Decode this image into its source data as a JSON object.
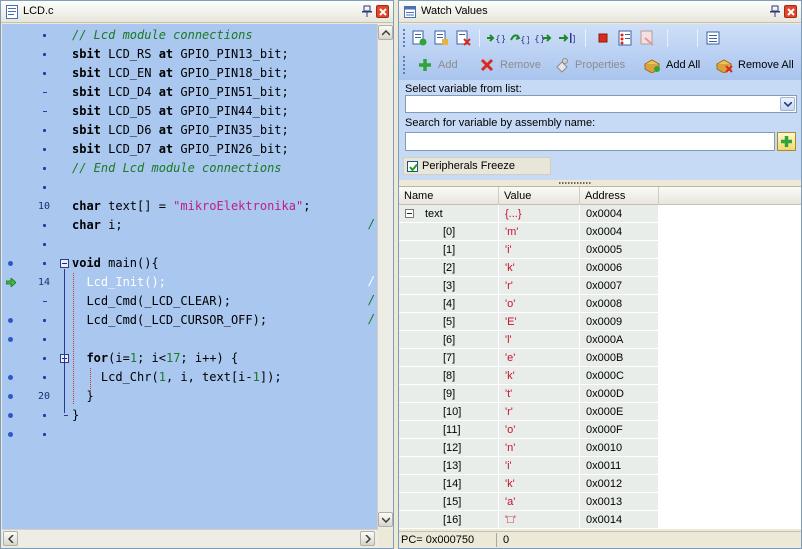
{
  "editor": {
    "title": "LCD.c",
    "gutter_numbers": [
      "10",
      "14",
      "20"
    ],
    "lines": [
      {
        "segments": [
          {
            "c": "cm",
            "t": "// Lcd module connections"
          }
        ]
      },
      {
        "segments": [
          {
            "c": "kw",
            "t": "sbit"
          },
          {
            "c": "plain",
            "t": " LCD_RS "
          },
          {
            "c": "kw",
            "t": "at"
          },
          {
            "c": "plain",
            "t": " GPIO_PIN13_bit;"
          }
        ]
      },
      {
        "segments": [
          {
            "c": "kw",
            "t": "sbit"
          },
          {
            "c": "plain",
            "t": " LCD_EN "
          },
          {
            "c": "kw",
            "t": "at"
          },
          {
            "c": "plain",
            "t": " GPIO_PIN18_bit;"
          }
        ]
      },
      {
        "segments": [
          {
            "c": "kw",
            "t": "sbit"
          },
          {
            "c": "plain",
            "t": " LCD_D4 "
          },
          {
            "c": "kw",
            "t": "at"
          },
          {
            "c": "plain",
            "t": " GPIO_PIN51_bit;"
          }
        ]
      },
      {
        "segments": [
          {
            "c": "kw",
            "t": "sbit"
          },
          {
            "c": "plain",
            "t": " LCD_D5 "
          },
          {
            "c": "kw",
            "t": "at"
          },
          {
            "c": "plain",
            "t": " GPIO_PIN44_bit;"
          }
        ]
      },
      {
        "segments": [
          {
            "c": "kw",
            "t": "sbit"
          },
          {
            "c": "plain",
            "t": " LCD_D6 "
          },
          {
            "c": "kw",
            "t": "at"
          },
          {
            "c": "plain",
            "t": " GPIO_PIN35_bit;"
          }
        ]
      },
      {
        "segments": [
          {
            "c": "kw",
            "t": "sbit"
          },
          {
            "c": "plain",
            "t": " LCD_D7 "
          },
          {
            "c": "kw",
            "t": "at"
          },
          {
            "c": "plain",
            "t": " GPIO_PIN26_bit;"
          }
        ]
      },
      {
        "segments": [
          {
            "c": "cm",
            "t": "// End Lcd module connections"
          }
        ]
      },
      {
        "segments": []
      },
      {
        "segments": [
          {
            "c": "kw",
            "t": "char"
          },
          {
            "c": "plain",
            "t": " text[] = "
          },
          {
            "c": "str",
            "t": "\"mikroElektronika\""
          },
          {
            "c": "plain",
            "t": ";"
          }
        ]
      },
      {
        "segments": [
          {
            "c": "kw",
            "t": "char"
          },
          {
            "c": "plain",
            "t": " i;"
          }
        ]
      },
      {
        "segments": []
      },
      {
        "segments": [
          {
            "c": "kw",
            "t": "void"
          },
          {
            "c": "plain",
            "t": " main(){"
          }
        ]
      },
      {
        "segments": [
          {
            "c": "plain",
            "t": "  Lcd_Init();"
          }
        ]
      },
      {
        "segments": [
          {
            "c": "plain",
            "t": "  Lcd_Cmd(_LCD_CLEAR);"
          }
        ]
      },
      {
        "segments": [
          {
            "c": "plain",
            "t": "  Lcd_Cmd(_LCD_CURSOR_OFF);"
          }
        ]
      },
      {
        "segments": []
      },
      {
        "segments": [
          {
            "c": "plain",
            "t": "  "
          },
          {
            "c": "kw",
            "t": "for"
          },
          {
            "c": "plain",
            "t": "(i="
          },
          {
            "c": "nm",
            "t": "1"
          },
          {
            "c": "plain",
            "t": "; i<"
          },
          {
            "c": "nm",
            "t": "17"
          },
          {
            "c": "plain",
            "t": "; i++) {"
          }
        ]
      },
      {
        "segments": [
          {
            "c": "plain",
            "t": "    Lcd_Chr("
          },
          {
            "c": "nm",
            "t": "1"
          },
          {
            "c": "plain",
            "t": ", i, text[i-"
          },
          {
            "c": "nm",
            "t": "1"
          },
          {
            "c": "plain",
            "t": "]);"
          }
        ]
      },
      {
        "segments": [
          {
            "c": "plain",
            "t": "  }"
          }
        ]
      },
      {
        "segments": [
          {
            "c": "plain",
            "t": "}"
          }
        ]
      }
    ],
    "slash_char": "/"
  },
  "watch": {
    "title": "Watch Values",
    "toolbar": {
      "add_label": "Add",
      "remove_label": "Remove",
      "properties_label": "Properties",
      "add_all_label": "Add All",
      "remove_all_label": "Remove All"
    },
    "select_label": "Select variable from list:",
    "select_value": "",
    "search_label": "Search for variable by assembly name:",
    "search_value": "",
    "freeze_label": "Peripherals Freeze",
    "freeze_checked": true,
    "columns": {
      "name": "Name",
      "value": "Value",
      "address": "Address"
    },
    "parent": {
      "name": "text",
      "value": "{...}",
      "address": "0x0004"
    },
    "rows": [
      {
        "name": "[0]",
        "value": "'m'",
        "address": "0x0004"
      },
      {
        "name": "[1]",
        "value": "'i'",
        "address": "0x0005"
      },
      {
        "name": "[2]",
        "value": "'k'",
        "address": "0x0006"
      },
      {
        "name": "[3]",
        "value": "'r'",
        "address": "0x0007"
      },
      {
        "name": "[4]",
        "value": "'o'",
        "address": "0x0008"
      },
      {
        "name": "[5]",
        "value": "'E'",
        "address": "0x0009"
      },
      {
        "name": "[6]",
        "value": "'l'",
        "address": "0x000A"
      },
      {
        "name": "[7]",
        "value": "'e'",
        "address": "0x000B"
      },
      {
        "name": "[8]",
        "value": "'k'",
        "address": "0x000C"
      },
      {
        "name": "[9]",
        "value": "'t'",
        "address": "0x000D"
      },
      {
        "name": "[10]",
        "value": "'r'",
        "address": "0x000E"
      },
      {
        "name": "[11]",
        "value": "'o'",
        "address": "0x000F"
      },
      {
        "name": "[12]",
        "value": "'n'",
        "address": "0x0010"
      },
      {
        "name": "[13]",
        "value": "'i'",
        "address": "0x0011"
      },
      {
        "name": "[14]",
        "value": "'k'",
        "address": "0x0012"
      },
      {
        "name": "[15]",
        "value": "'a'",
        "address": "0x0013"
      },
      {
        "name": "[16]",
        "value": "'□'",
        "address": "0x0014"
      }
    ],
    "status_pc": "PC= 0x000750",
    "status_value": "0"
  },
  "colors": {
    "editor_bg": "#a9c7ef",
    "highlight": "#0a2bd9",
    "toolbar_bg": "#b9d1f3"
  }
}
